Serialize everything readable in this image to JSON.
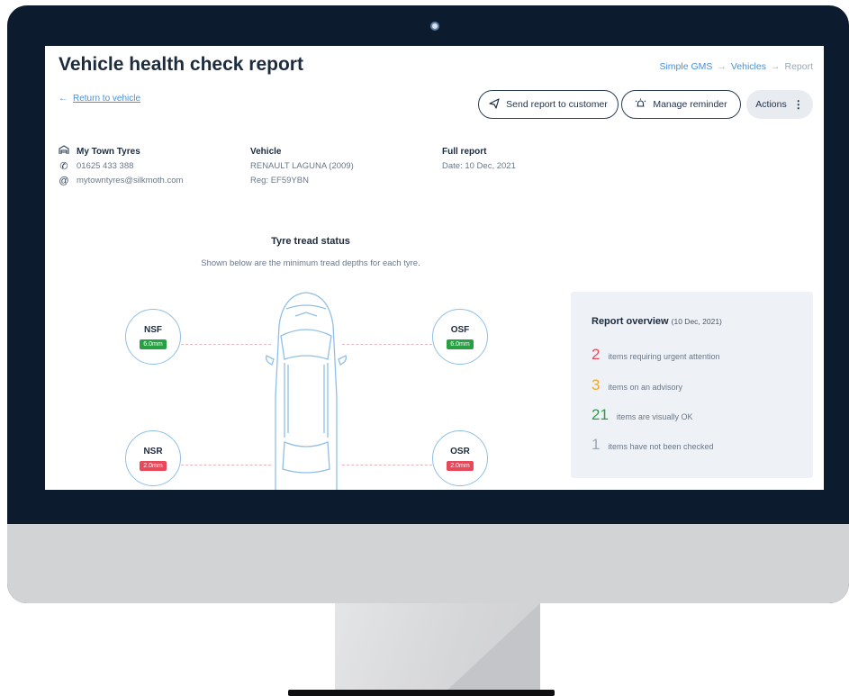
{
  "page": {
    "title": "Vehicle health check report",
    "breadcrumb": [
      "Simple GMS",
      "Vehicles",
      "Report"
    ],
    "back_link": "Return to vehicle"
  },
  "buttons": {
    "send": "Send report to customer",
    "reminder": "Manage reminder",
    "actions": "Actions"
  },
  "garage": {
    "name": "My Town Tyres",
    "phone": "01625 433 388",
    "email": "mytowntyres@silkmoth.com"
  },
  "vehicle": {
    "heading": "Vehicle",
    "model": "RENAULT LAGUNA (2009)",
    "reg": "Reg: EF59YBN"
  },
  "report": {
    "heading": "Full report",
    "date": "Date: 10 Dec, 2021"
  },
  "tread": {
    "title": "Tyre tread status",
    "subtitle": "Shown below are the minimum tread depths for each tyre.",
    "tyres": {
      "nsf": {
        "label": "NSF",
        "depth": "6.0mm",
        "status": "ok"
      },
      "osf": {
        "label": "OSF",
        "depth": "6.0mm",
        "status": "ok"
      },
      "nsr": {
        "label": "NSR",
        "depth": "2.0mm",
        "status": "bad"
      },
      "osr": {
        "label": "OSR",
        "depth": "2.0mm",
        "status": "bad"
      }
    }
  },
  "overview": {
    "title": "Report overview",
    "date": "(10 Dec, 2021)",
    "items": [
      {
        "count": "2",
        "text": "items requiring urgent attention",
        "color": "#e8495a"
      },
      {
        "count": "3",
        "text": "items on an advisory",
        "color": "#f0a830"
      },
      {
        "count": "21",
        "text": "items are visually OK",
        "color": "#27a043"
      },
      {
        "count": "1",
        "text": "items have not been checked",
        "color": "#9aa7b6"
      }
    ]
  },
  "icons": {
    "back": "arrow-left-icon",
    "send": "paper-plane-icon",
    "reminder": "alarm-icon",
    "actions": "more-vertical-icon",
    "garage": "garage-icon",
    "phone": "phone-icon",
    "email": "at-icon"
  }
}
